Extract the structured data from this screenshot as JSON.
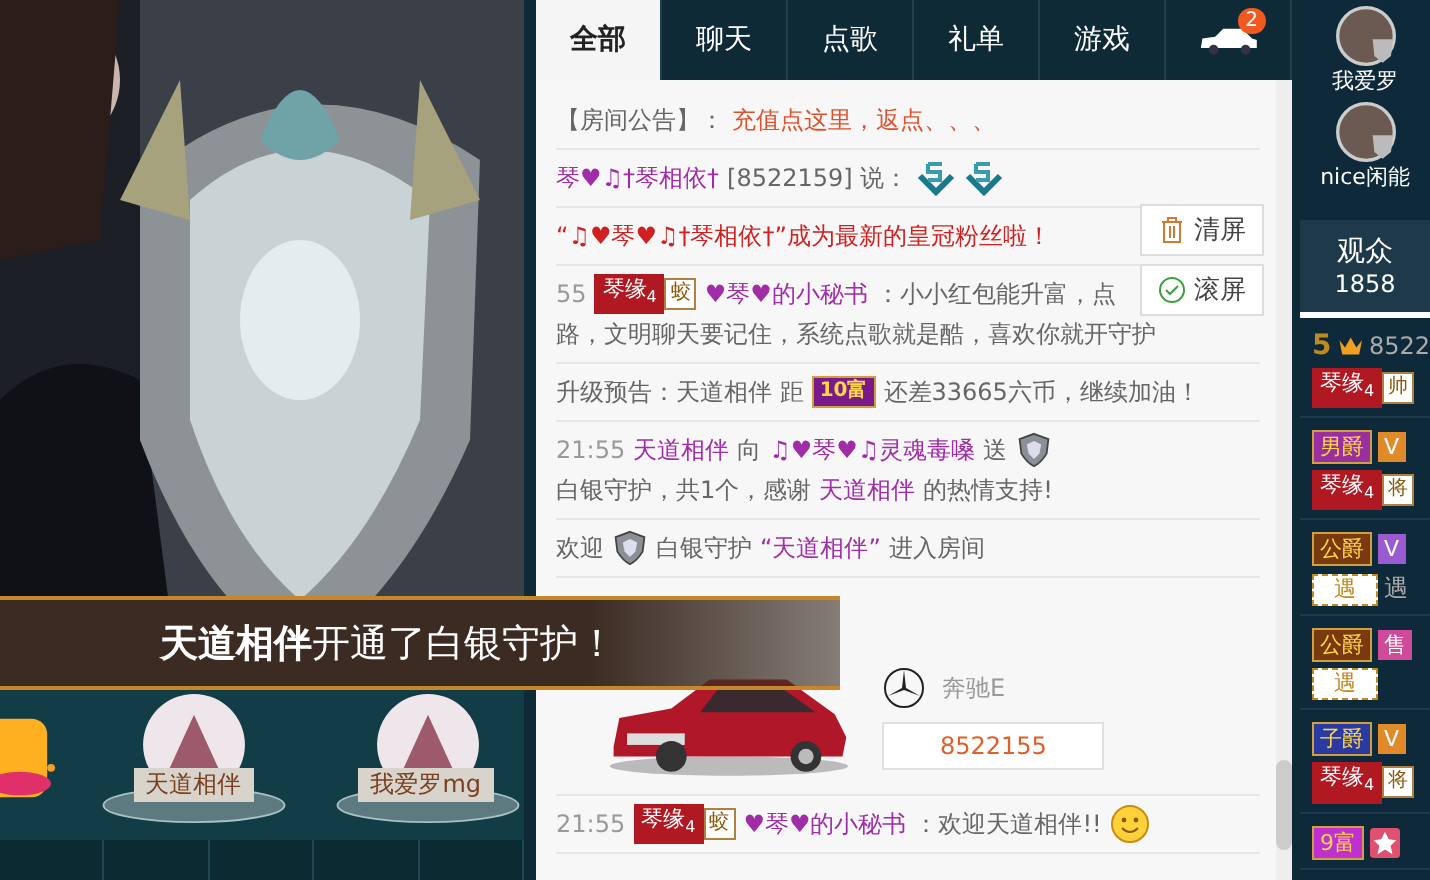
{
  "stage": {
    "banner": "**天道相伴**开通了白银守护！",
    "fans": [
      {
        "name": "天道相伴"
      },
      {
        "name": "我爱罗mg"
      }
    ]
  },
  "tabs": [
    {
      "kind": "text",
      "label": "全部",
      "selected": true
    },
    {
      "kind": "text",
      "label": "聊天",
      "selected": false
    },
    {
      "kind": "text",
      "label": "点歌",
      "selected": false
    },
    {
      "kind": "text",
      "label": "礼单",
      "selected": false
    },
    {
      "kind": "text",
      "label": "游戏",
      "selected": false
    },
    {
      "kind": "car",
      "badge": "2",
      "selected": false
    }
  ],
  "chat": [
    {
      "kind": "line",
      "segments": [
        {
          "kind": "text",
          "text": "【房间公告】："
        },
        {
          "kind": "notice",
          "text": "充值点这里，返点、、、"
        }
      ]
    },
    {
      "kind": "line",
      "segments": [
        {
          "kind": "name",
          "text": "琴♥♫†琴相依†"
        },
        {
          "kind": "text",
          "text": "[8522159] 说："
        },
        {
          "kind": "emoji5"
        },
        {
          "kind": "emoji5"
        }
      ]
    },
    {
      "kind": "line",
      "segments": [
        {
          "kind": "alert",
          "text": "“♫♥琴♥♫†琴相依†”成为最新的皇冠粉丝啦！"
        }
      ]
    },
    {
      "kind": "line",
      "segments": [
        {
          "kind": "time",
          "text": "55"
        },
        {
          "kind": "fan",
          "label": "琴缘",
          "grade": "4",
          "rank": "蛟"
        },
        {
          "kind": "name",
          "text": "♥琴♥的小秘书"
        },
        {
          "kind": "text",
          "text": "：小小红包能升富，点"
        },
        {
          "kind": "text",
          "text": "路，文明聊天要记住，系统点歌就是酷，喜欢你就开守护"
        }
      ]
    },
    {
      "kind": "line",
      "segments": [
        {
          "kind": "text",
          "text": "升级预告：天道相伴 距"
        },
        {
          "kind": "rich",
          "text": "10富"
        },
        {
          "kind": "text",
          "text": "还差33665六币，继续加油！"
        }
      ]
    },
    {
      "kind": "line",
      "segments": [
        {
          "kind": "time",
          "text": "21:55"
        },
        {
          "kind": "name",
          "text": "天道相伴"
        },
        {
          "kind": "text",
          "text": "向"
        },
        {
          "kind": "name",
          "text": "♫♥琴♥♫灵魂毒嗓"
        },
        {
          "kind": "text",
          "text": "送"
        },
        {
          "kind": "shield"
        },
        {
          "kind": "text",
          "text": "白银守护，共1个，感谢"
        },
        {
          "kind": "name",
          "text": "天道相伴"
        },
        {
          "kind": "text",
          "text": "的热情支持!"
        }
      ]
    },
    {
      "kind": "line",
      "segments": [
        {
          "kind": "text",
          "text": "欢迎"
        },
        {
          "kind": "shield"
        },
        {
          "kind": "text",
          "text": "白银守护"
        },
        {
          "kind": "name",
          "text": "“天道相伴”"
        },
        {
          "kind": "text",
          "text": "进入房间"
        }
      ]
    },
    {
      "kind": "car",
      "brand": "奔驰E",
      "number": "8522155"
    },
    {
      "kind": "line",
      "segments": [
        {
          "kind": "time",
          "text": "21:55"
        },
        {
          "kind": "fan",
          "label": "琴缘",
          "grade": "4",
          "rank": "蛟"
        },
        {
          "kind": "name",
          "text": "♥琴♥的小秘书"
        },
        {
          "kind": "text",
          "text": "：欢迎天道相伴!!"
        },
        {
          "kind": "smile"
        }
      ]
    }
  ],
  "buttons": [
    {
      "kind": "trash",
      "label": "清屏"
    },
    {
      "kind": "check",
      "label": "滚屏"
    }
  ],
  "sidebar": {
    "users": [
      {
        "name": "我爱罗"
      },
      {
        "name": "nice闲能"
      }
    ],
    "audience": {
      "label": "观众",
      "count": "1858",
      "selected": true
    },
    "members": [
      {
        "lines": [
          [
            {
              "kind": "num",
              "text": "5"
            },
            {
              "kind": "crown"
            },
            {
              "kind": "text",
              "text": "8522"
            }
          ],
          [
            {
              "kind": "fan",
              "label": "琴缘",
              "grade": "4",
              "rank": "帅"
            }
          ]
        ]
      },
      {
        "lines": [
          [
            {
              "kind": "title",
              "text": "男爵",
              "color": "#9a2fa0"
            },
            {
              "kind": "vip",
              "text": "V",
              "color": "#e08a2a"
            }
          ],
          [
            {
              "kind": "fan",
              "label": "琴缘",
              "grade": "4",
              "rank": "将"
            }
          ]
        ]
      },
      {
        "lines": [
          [
            {
              "kind": "title",
              "text": "公爵",
              "color": "#7a3a10"
            },
            {
              "kind": "vip",
              "text": "V",
              "color": "#9a5ad0"
            }
          ],
          [
            {
              "kind": "tag",
              "text": "遇"
            },
            {
              "kind": "text",
              "text": "遇"
            }
          ]
        ]
      },
      {
        "lines": [
          [
            {
              "kind": "title",
              "text": "公爵",
              "color": "#7a3a10"
            },
            {
              "kind": "vip",
              "text": "售",
              "color": "#d04a9a"
            }
          ],
          [
            {
              "kind": "tag",
              "text": "遇"
            }
          ]
        ]
      },
      {
        "lines": [
          [
            {
              "kind": "title",
              "text": "子爵",
              "color": "#2a3aa0"
            },
            {
              "kind": "vip",
              "text": "V",
              "color": "#e08a2a"
            }
          ],
          [
            {
              "kind": "fan",
              "label": "琴缘",
              "grade": "4",
              "rank": "将"
            }
          ]
        ]
      },
      {
        "lines": [
          [
            {
              "kind": "title",
              "text": "9富",
              "color": "#c030d0"
            },
            {
              "kind": "star",
              "color": "#e05070"
            }
          ]
        ]
      }
    ]
  }
}
